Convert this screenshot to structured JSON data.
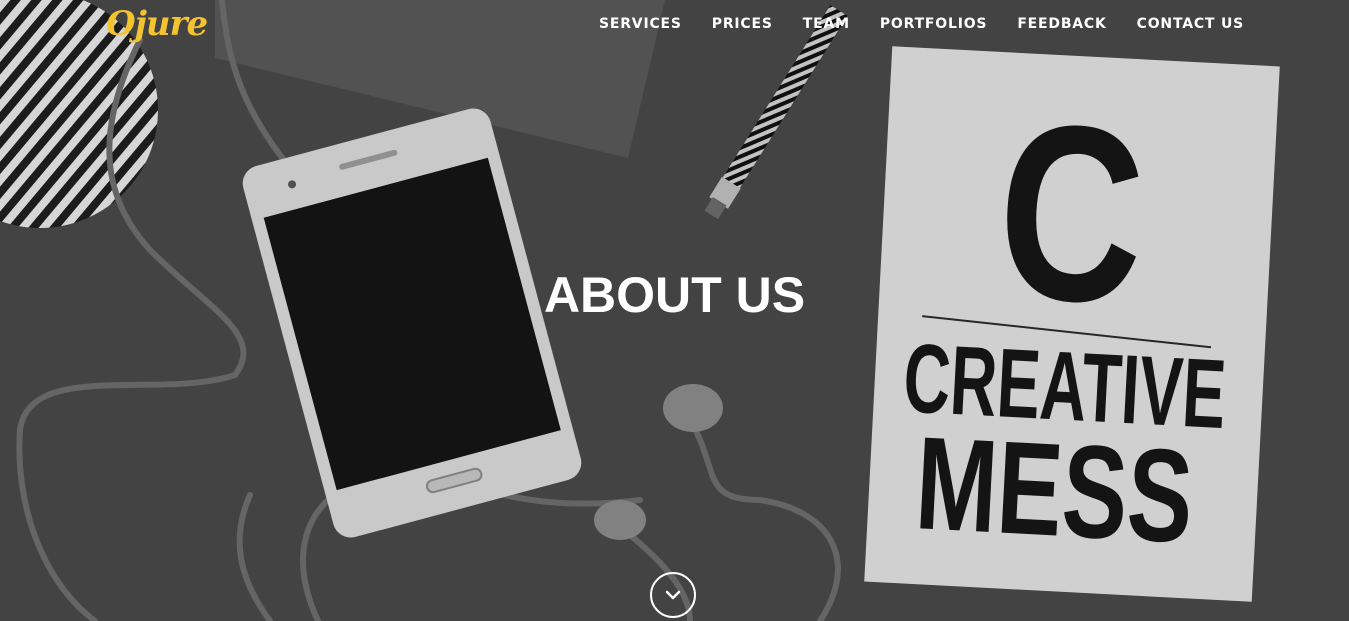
{
  "brand": {
    "logo_text": "Ojure",
    "accent_color": "#f4c430"
  },
  "nav": {
    "items": [
      {
        "label": "SERVICES"
      },
      {
        "label": "PRICES"
      },
      {
        "label": "TEAM"
      },
      {
        "label": "PORTFOLIOS"
      },
      {
        "label": "FEEDBACK"
      },
      {
        "label": "CONTACT US"
      }
    ]
  },
  "hero": {
    "title": "ABOUT US",
    "scroll_icon": "chevron-down-icon",
    "background": {
      "notebook_letter": "C",
      "notebook_line1": "CREATIVE",
      "notebook_line2": "MESS"
    }
  }
}
